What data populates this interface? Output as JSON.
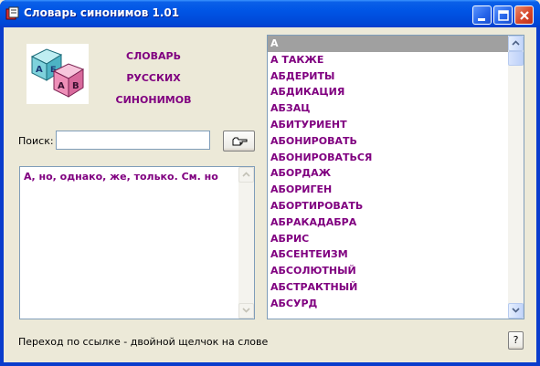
{
  "window": {
    "title": "Словарь синонимов 1.01",
    "icon": "book-icon"
  },
  "logo": {
    "icon": "abc-blocks-icon",
    "lines": [
      "СЛОВАРЬ",
      "РУССКИХ",
      "СИНОНИМОВ"
    ]
  },
  "search": {
    "label": "Поиск:",
    "value": "",
    "button_icon": "pointing-hand-icon"
  },
  "definition": {
    "text": "А, но, однако, же, только. См. но"
  },
  "word_list": {
    "selected": "А",
    "items": [
      "А",
      "А ТАКЖЕ",
      "АБДЕРИТЫ",
      "АБДИКАЦИЯ",
      "АБЗАЦ",
      "АБИТУРИЕНТ",
      "АБОНИРОВАТЬ",
      "АБОНИРОВАТЬСЯ",
      "АБОРДАЖ",
      "АБОРИГЕН",
      "АБОРТИРОВАТЬ",
      "АБРАКАДАБРА",
      "АБРИС",
      "АБСЕНТЕИЗМ",
      "АБСОЛЮТНЫЙ",
      "АБСТРАКТНЫЙ",
      "АБСУРД"
    ]
  },
  "status": {
    "text": "Переход по ссылке - двойной щелчок на слове",
    "help_label": "?"
  },
  "colors": {
    "accent": "#800080",
    "selection": "#a0a0a0",
    "titlebar": "#0055e5"
  }
}
